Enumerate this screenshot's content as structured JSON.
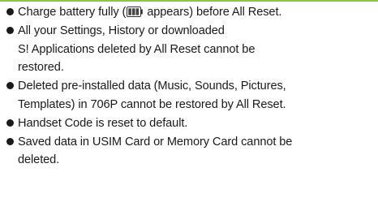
{
  "notes": [
    {
      "text_before": "Charge battery fully (",
      "icon": "battery-full-icon",
      "text_after": " appears) before All Reset."
    },
    {
      "lines": [
        "All your Settings, History or downloaded",
        "S! Applications deleted by All Reset cannot be",
        "restored."
      ]
    },
    {
      "lines": [
        "Deleted pre-installed data (Music, Sounds, Pictures,",
        "Templates) in 706P cannot be restored by All Reset."
      ]
    },
    {
      "lines": [
        "Handset Code is reset to default."
      ]
    },
    {
      "lines": [
        "Saved data in USIM Card or Memory Card cannot be",
        "deleted."
      ]
    }
  ],
  "colors": {
    "accent_rule": "#8cc63f",
    "text": "#1a1a1a"
  }
}
